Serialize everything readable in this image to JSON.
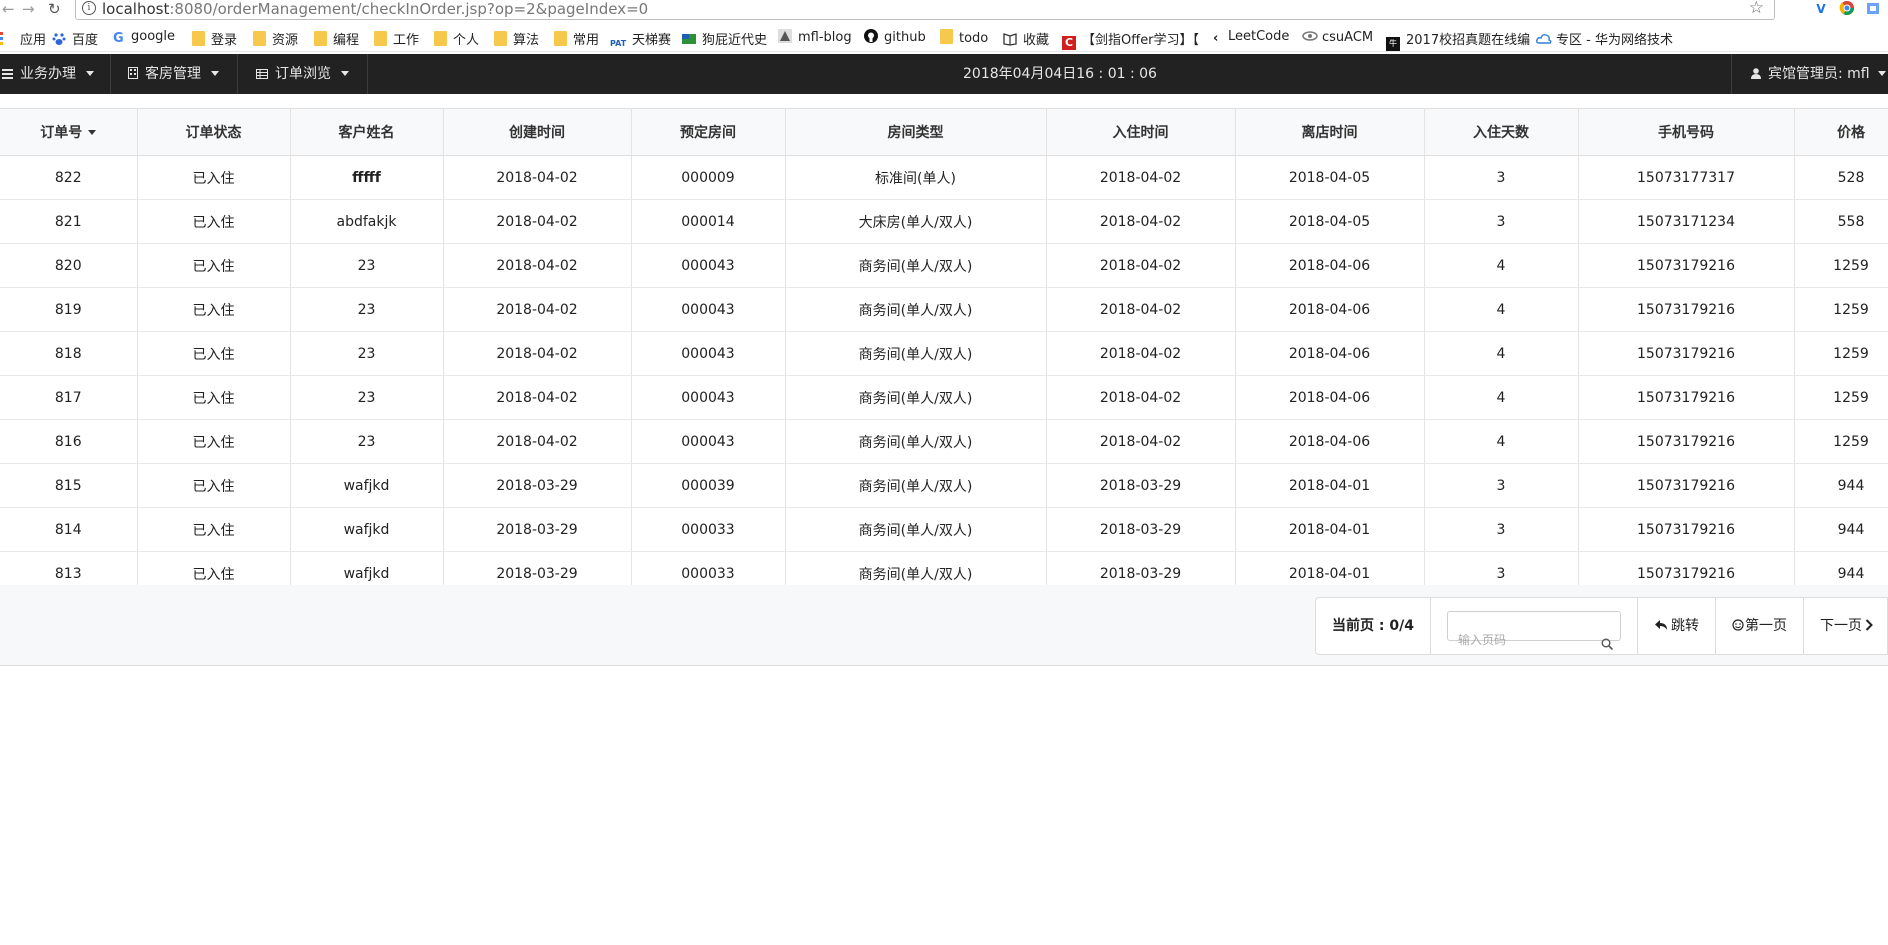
{
  "browser": {
    "url_host": "localhost",
    "url_rest": ":8080/orderManagement/checkInOrder.jsp?op=2&pageIndex=0",
    "back_glyph": "←",
    "forward_glyph": "→",
    "reload_glyph": "↻",
    "star_glyph": "☆"
  },
  "bookmarks": [
    {
      "label": "应用",
      "icon": "apps-grid-icon"
    },
    {
      "label": "百度",
      "icon": "baidu-paw-icon"
    },
    {
      "label": "google",
      "icon": "google-g-icon"
    },
    {
      "label": "登录",
      "icon": "folder-icon"
    },
    {
      "label": "资源",
      "icon": "folder-icon"
    },
    {
      "label": "编程",
      "icon": "folder-icon"
    },
    {
      "label": "工作",
      "icon": "folder-icon"
    },
    {
      "label": "个人",
      "icon": "folder-icon"
    },
    {
      "label": "算法",
      "icon": "folder-icon"
    },
    {
      "label": "常用",
      "icon": "folder-icon"
    },
    {
      "label": "天梯赛",
      "icon": "pat-icon"
    },
    {
      "label": "狗屁近代史",
      "icon": "flag-icon"
    },
    {
      "label": "mfl-blog",
      "icon": "blog-icon"
    },
    {
      "label": "github",
      "icon": "github-icon"
    },
    {
      "label": "todo",
      "icon": "folder-icon"
    },
    {
      "label": "收藏",
      "icon": "book-icon"
    },
    {
      "label": "【剑指Offer学习】【",
      "icon": "c-logo-icon"
    },
    {
      "label": "LeetCode",
      "icon": "leetcode-icon"
    },
    {
      "label": "csuACM",
      "icon": "acm-icon"
    },
    {
      "label": "2017校招真题在线编",
      "icon": "nowcoder-icon"
    },
    {
      "label": "专区 - 华为网络技术",
      "icon": "cloud-icon"
    }
  ],
  "navbar": {
    "business": "业务办理",
    "rooms": "客房管理",
    "orders": "订单浏览",
    "clock": "2018年04月04日16 : 01 : 06",
    "user": "宾馆管理员: mfl"
  },
  "table": {
    "headers": [
      "订单号",
      "订单状态",
      "客户姓名",
      "创建时间",
      "预定房间",
      "房间类型",
      "入住时间",
      "离店时间",
      "入住天数",
      "手机号码",
      "价格"
    ],
    "rows": [
      [
        "822",
        "已入住",
        "fffff",
        "2018-04-02",
        "000009",
        "标准间(单人)",
        "2018-04-02",
        "2018-04-05",
        "3",
        "15073177317",
        "528"
      ],
      [
        "821",
        "已入住",
        "abdfakjk",
        "2018-04-02",
        "000014",
        "大床房(单人/双人)",
        "2018-04-02",
        "2018-04-05",
        "3",
        "15073171234",
        "558"
      ],
      [
        "820",
        "已入住",
        "23",
        "2018-04-02",
        "000043",
        "商务间(单人/双人)",
        "2018-04-02",
        "2018-04-06",
        "4",
        "15073179216",
        "1259"
      ],
      [
        "819",
        "已入住",
        "23",
        "2018-04-02",
        "000043",
        "商务间(单人/双人)",
        "2018-04-02",
        "2018-04-06",
        "4",
        "15073179216",
        "1259"
      ],
      [
        "818",
        "已入住",
        "23",
        "2018-04-02",
        "000043",
        "商务间(单人/双人)",
        "2018-04-02",
        "2018-04-06",
        "4",
        "15073179216",
        "1259"
      ],
      [
        "817",
        "已入住",
        "23",
        "2018-04-02",
        "000043",
        "商务间(单人/双人)",
        "2018-04-02",
        "2018-04-06",
        "4",
        "15073179216",
        "1259"
      ],
      [
        "816",
        "已入住",
        "23",
        "2018-04-02",
        "000043",
        "商务间(单人/双人)",
        "2018-04-02",
        "2018-04-06",
        "4",
        "15073179216",
        "1259"
      ],
      [
        "815",
        "已入住",
        "wafjkd",
        "2018-03-29",
        "000039",
        "商务间(单人/双人)",
        "2018-03-29",
        "2018-04-01",
        "3",
        "15073179216",
        "944"
      ],
      [
        "814",
        "已入住",
        "wafjkd",
        "2018-03-29",
        "000033",
        "商务间(单人/双人)",
        "2018-03-29",
        "2018-04-01",
        "3",
        "15073179216",
        "944"
      ],
      [
        "813",
        "已入住",
        "wafjkd",
        "2018-03-29",
        "000033",
        "商务间(单人/双人)",
        "2018-03-29",
        "2018-04-01",
        "3",
        "15073179216",
        "944"
      ]
    ]
  },
  "pager": {
    "current": "当前页 : 0/4",
    "input_placeholder": "输入页码",
    "jump": "跳转",
    "first": "第一页",
    "next": "下一页"
  },
  "colors": {
    "navbar_bg": "#222222",
    "header_bg": "#f8f9fa",
    "folder": "#f6c94c"
  }
}
